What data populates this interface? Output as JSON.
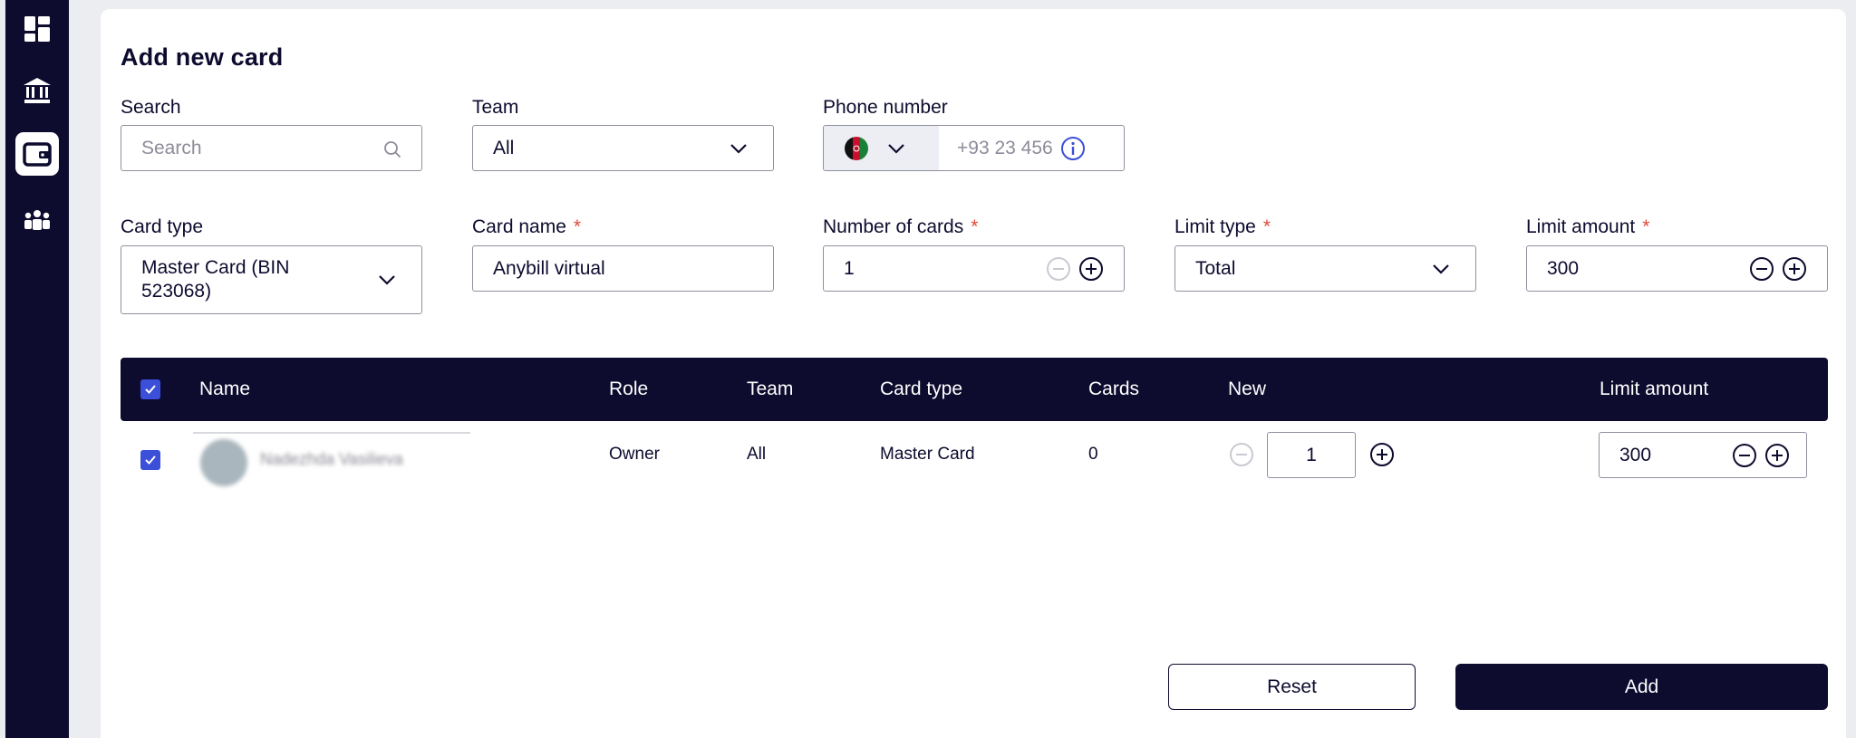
{
  "sidebar": {
    "items": [
      {
        "icon": "dashboard-icon",
        "active": false
      },
      {
        "icon": "bank-icon",
        "active": false
      },
      {
        "icon": "wallet-icon",
        "active": true
      },
      {
        "icon": "team-icon",
        "active": false
      }
    ]
  },
  "form": {
    "title": "Add new card",
    "search": {
      "label": "Search",
      "placeholder": "Search"
    },
    "team": {
      "label": "Team",
      "value": "All"
    },
    "phone": {
      "label": "Phone number",
      "placeholder": "+93 23 456"
    },
    "card_type": {
      "label": "Card type",
      "value": "Master Card (BIN 523068)"
    },
    "card_name": {
      "label": "Card name",
      "required": "*",
      "value": "Anybill virtual"
    },
    "number_of_cards": {
      "label": "Number of cards",
      "required": "*",
      "value": "1"
    },
    "limit_type": {
      "label": "Limit type",
      "required": "*",
      "value": "Total"
    },
    "limit_amount": {
      "label": "Limit amount",
      "required": "*",
      "value": "300"
    }
  },
  "table": {
    "headers": {
      "name": "Name",
      "role": "Role",
      "team": "Team",
      "card_type": "Card type",
      "cards": "Cards",
      "new": "New",
      "limit_amount": "Limit amount"
    },
    "rows": [
      {
        "name": "Nadezhda Vasilieva",
        "role": "Owner",
        "team": "All",
        "card_type": "Master Card",
        "cards": "0",
        "new": "1",
        "limit_amount": "300"
      }
    ]
  },
  "actions": {
    "reset": "Reset",
    "add": "Add"
  },
  "colors": {
    "navy": "#0d0b2e",
    "checkbox": "#3b4fd8",
    "required": "#e0493b",
    "info": "#3b4fd8"
  }
}
